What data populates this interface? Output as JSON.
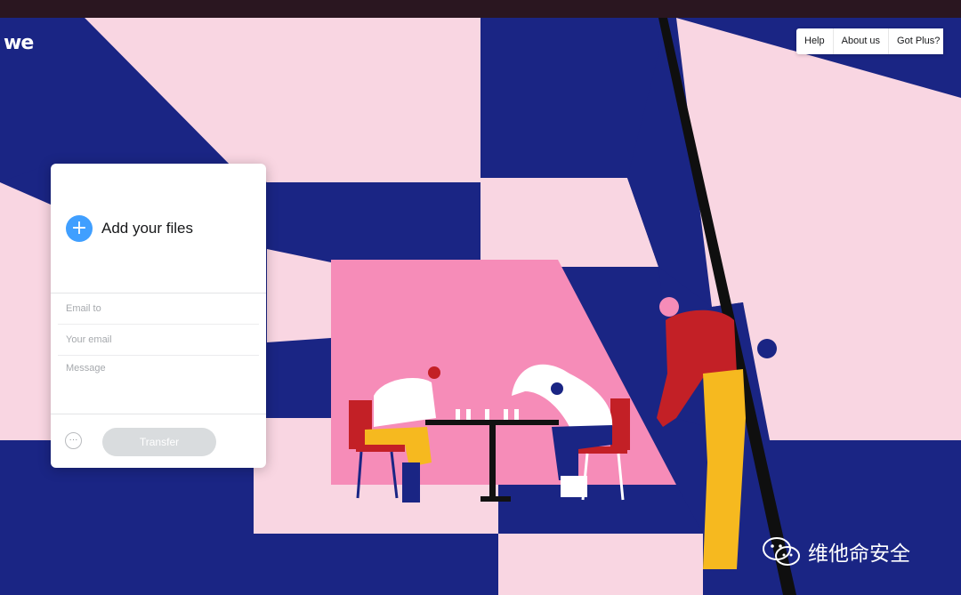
{
  "logo": {
    "text": "we"
  },
  "nav": {
    "items": [
      {
        "label": "Help"
      },
      {
        "label": "About us"
      },
      {
        "label": "Got Plus?"
      }
    ]
  },
  "upload": {
    "add_files_label": "Add your files",
    "email_to_placeholder": "Email to",
    "your_email_placeholder": "Your email",
    "message_placeholder": "Message",
    "more_icon_glyph": "···",
    "transfer_label": "Transfer"
  },
  "watermark": {
    "text": "维他命安全"
  },
  "colors": {
    "navy": "#1a2584",
    "light_pink": "#f9d6e2",
    "hot_pink": "#f68cb8",
    "accent_blue": "#409fff",
    "red": "#c32026",
    "yellow": "#f6b91f"
  }
}
